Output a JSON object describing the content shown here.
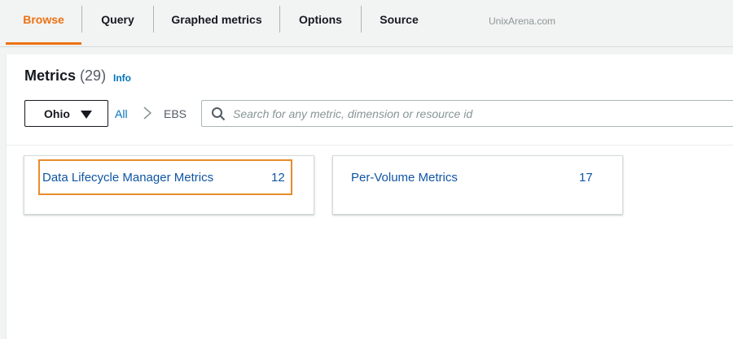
{
  "tabs": [
    {
      "label": "Browse",
      "active": true
    },
    {
      "label": "Query",
      "active": false
    },
    {
      "label": "Graphed metrics",
      "active": false
    },
    {
      "label": "Options",
      "active": false
    },
    {
      "label": "Source",
      "active": false
    }
  ],
  "watermark": "UnixArena.com",
  "metrics": {
    "title": "Metrics",
    "count": "(29)",
    "info_label": "Info"
  },
  "filter": {
    "region": "Ohio",
    "breadcrumb_all": "All",
    "breadcrumb_current": "EBS",
    "search_placeholder": "Search for any metric, dimension or resource id",
    "search_value": ""
  },
  "cards": [
    {
      "name": "Data Lifecycle Manager Metrics",
      "count": "12",
      "highlighted": true
    },
    {
      "name": "Per-Volume Metrics",
      "count": "17",
      "highlighted": false
    }
  ],
  "colors": {
    "active_tab": "#ec7211",
    "link": "#0073bb",
    "card_text": "#0f55a4",
    "highlight_border": "#e88c2c"
  },
  "icons": {
    "caret": "caret-down-icon",
    "breadcrumb_separator": "chevron-right-icon",
    "search": "search-icon"
  }
}
